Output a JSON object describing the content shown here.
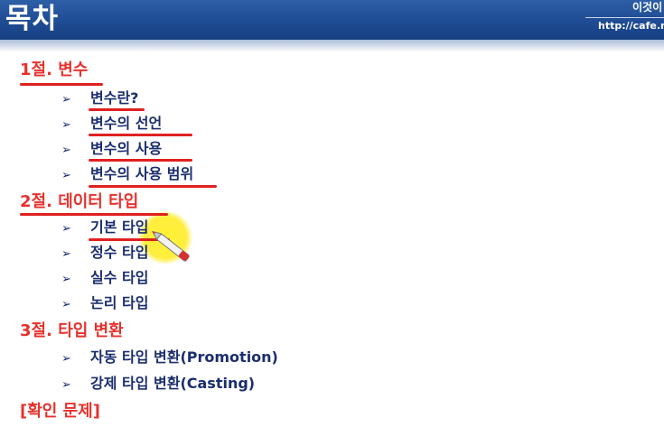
{
  "header": {
    "title": "목차",
    "brand_name": "이것이",
    "brand_url": "http://cafe.n"
  },
  "arrow_glyph": "➢",
  "toc": [
    {
      "kind": "section",
      "text": "1절. 변수"
    },
    {
      "kind": "item",
      "text": "변수란?"
    },
    {
      "kind": "item",
      "text": "변수의 선언"
    },
    {
      "kind": "item",
      "text": "변수의 사용"
    },
    {
      "kind": "item",
      "text": "변수의 사용 범위"
    },
    {
      "kind": "section",
      "text": "2절. 데이터 타입"
    },
    {
      "kind": "item",
      "text": "기본 타입"
    },
    {
      "kind": "item",
      "text": "정수 타입"
    },
    {
      "kind": "item",
      "text": "실수 타입"
    },
    {
      "kind": "item",
      "text": "논리 타입"
    },
    {
      "kind": "section",
      "text": "3절. 타입 변환"
    },
    {
      "kind": "item",
      "text": "자동 타입 변환(Promotion)"
    },
    {
      "kind": "item",
      "text": "강제 타입 변환(Casting)"
    },
    {
      "kind": "section",
      "text": "[확인 문제]"
    }
  ],
  "colors": {
    "header_bg": "#1f4c94",
    "section_text": "#e5322d",
    "item_text": "#1b2e6e",
    "annotation_red": "#e02020",
    "highlight_yellow": "#ffeb1e"
  }
}
